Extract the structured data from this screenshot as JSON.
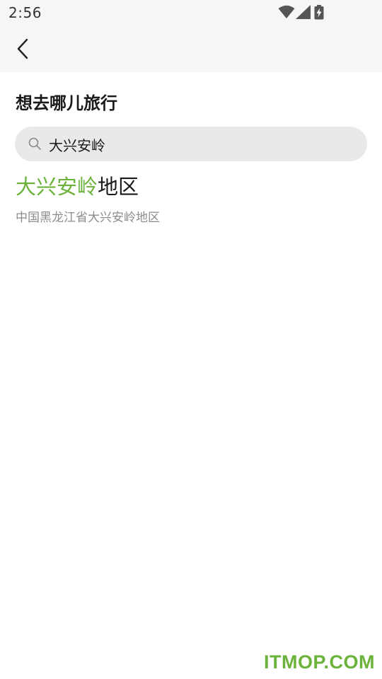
{
  "status_bar": {
    "time": "2:56",
    "icons": [
      "wifi-icon",
      "cellular-signal-icon",
      "battery-charging-icon"
    ]
  },
  "header": {
    "back_icon": "chevron-left-icon"
  },
  "page": {
    "title": "想去哪儿旅行"
  },
  "search": {
    "value": "大兴安岭",
    "icon": "search-icon"
  },
  "results": [
    {
      "title_highlight": "大兴安岭",
      "title_rest": "地区",
      "subtitle": "中国黑龙江省大兴安岭地区"
    }
  ],
  "watermark": "ITMOP.COM",
  "colors": {
    "accent": "#6ab23a",
    "header_bg": "#f6f6f6",
    "search_bg": "#e9e9e9",
    "subtitle": "#8c8c8c"
  }
}
